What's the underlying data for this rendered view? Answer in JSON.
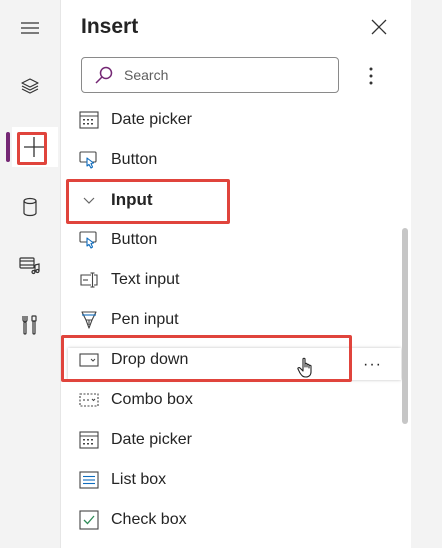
{
  "rail": {
    "items": [
      {
        "name": "hamburger-menu-icon"
      },
      {
        "name": "layers-icon"
      },
      {
        "name": "insert-plus-icon",
        "active": true
      },
      {
        "name": "data-cylinder-icon"
      },
      {
        "name": "media-icon"
      },
      {
        "name": "tools-icon"
      }
    ]
  },
  "panel": {
    "title": "Insert",
    "search": {
      "placeholder": "Search",
      "value": ""
    }
  },
  "list": {
    "items": [
      {
        "label": "Date picker",
        "icon": "calendar-icon"
      },
      {
        "label": "Button",
        "icon": "button-touch-icon"
      },
      {
        "label": "Input",
        "icon": "chevron-down-icon",
        "group": true
      },
      {
        "label": "Button",
        "icon": "button-touch-icon"
      },
      {
        "label": "Text input",
        "icon": "text-input-icon"
      },
      {
        "label": "Pen input",
        "icon": "pen-icon"
      },
      {
        "label": "Drop down",
        "icon": "dropdown-icon"
      },
      {
        "label": "Combo box",
        "icon": "combo-box-icon"
      },
      {
        "label": "Date picker",
        "icon": "calendar-icon"
      },
      {
        "label": "List box",
        "icon": "list-box-icon"
      },
      {
        "label": "Check box",
        "icon": "checkbox-icon"
      }
    ],
    "row_more": "···"
  },
  "colors": {
    "accent": "#742774",
    "highlight": "#e0443c",
    "icon_blue": "#0f6cbd"
  }
}
